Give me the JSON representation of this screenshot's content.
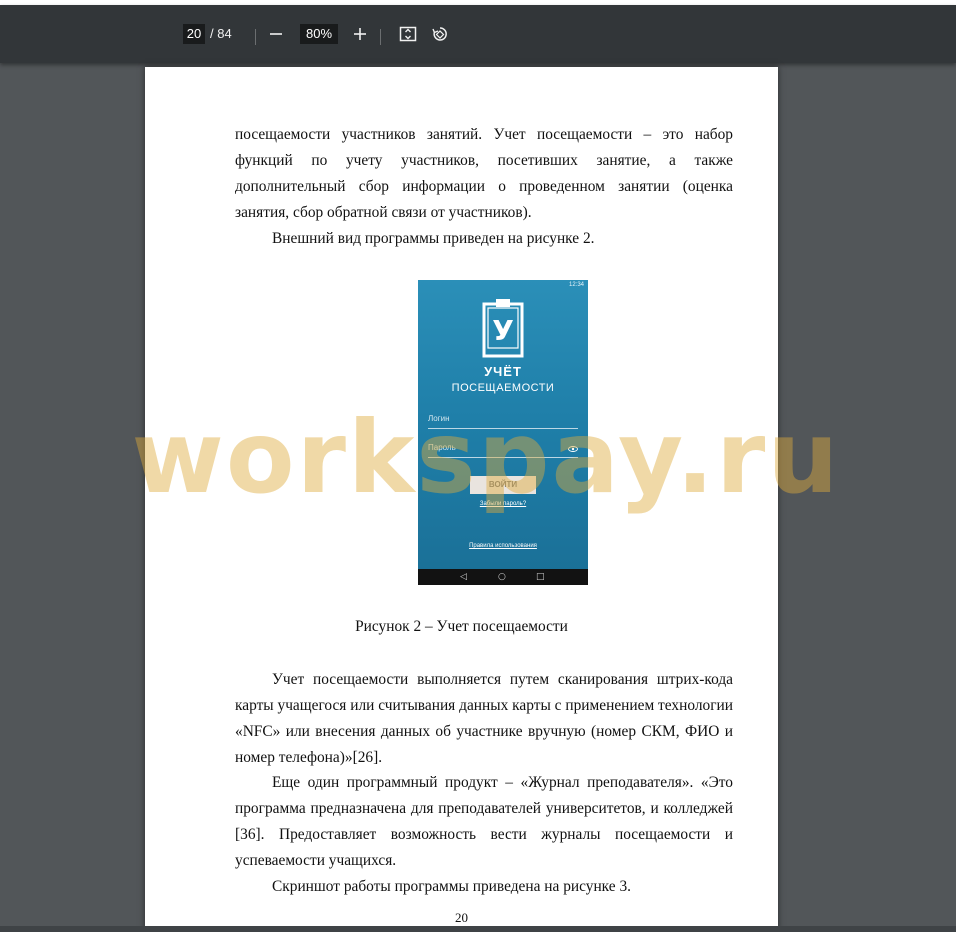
{
  "toolbar": {
    "page_current": "20",
    "page_total": "/ 84",
    "zoom_level": "80%",
    "icons": [
      "minus-icon",
      "plus-icon",
      "fit-page-icon",
      "rotate-icon"
    ]
  },
  "page": {
    "paragraphs": [
      "посещаемости участников занятий. Учет посещаемости – это набор функций по учету участников, посетивших занятие, а также дополнительный сбор информации о проведенном занятии (оценка занятия, сбор обратной связи от участников).",
      "Внешний вид программы приведен на рисунке 2.",
      "Учет посещаемости выполняется путем сканирования штрих-кода карты учащегося или считывания данных карты с применением технологии «NFC» или внесения данных об участнике вручную (номер СКМ, ФИО и номер телефона)»[26].",
      "Еще один программный продукт – «Журнал преподавателя». «Это программа предназначена для преподавателей университетов, и колледжей [36]. Предоставляет возможность вести журналы посещаемости и успеваемости учащихся.",
      "Скриншот работы программы приведена на рисунке 3."
    ],
    "caption": "Рисунок 2 – Учет посещаемости",
    "page_number": "20"
  },
  "figure": {
    "status_time": "12:34",
    "logo_letter": "У",
    "title": "УЧЁТ",
    "subtitle": "ПОСЕЩАЕМОСТИ",
    "login_placeholder": "Логин",
    "password_placeholder": "Пароль",
    "login_button": "ВОЙТИ",
    "forgot_link": "Забыли пароль?",
    "terms_link": "Правила использования",
    "nav_back": "◁",
    "nav_home": "○",
    "nav_recent": "□"
  },
  "watermark": "workspay.ru",
  "colors": {
    "toolbar_bg": "#323639",
    "viewer_bg": "#525659",
    "app_accent": "#1f7fa9",
    "watermark": "#deaa3c"
  }
}
